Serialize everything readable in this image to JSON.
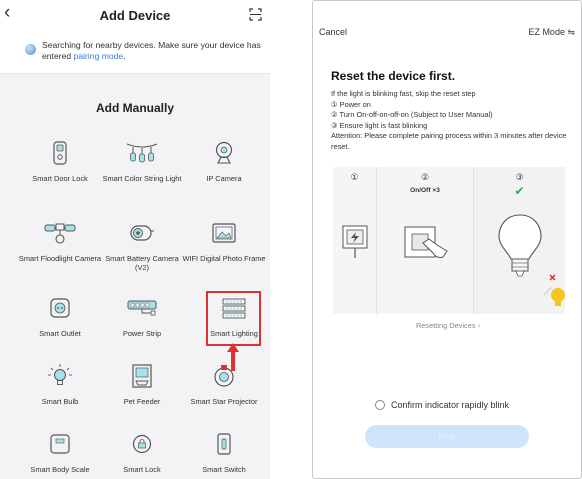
{
  "left": {
    "header": {
      "back": "‹",
      "title": "Add Device"
    },
    "search": {
      "text": "Searching for nearby devices. Make sure your device has entered ",
      "link": "pairing mode",
      "end": "."
    },
    "manual_title": "Add Manually",
    "devices": [
      {
        "label": "Smart Door Lock",
        "icon": "door-lock-icon"
      },
      {
        "label": "Smart Color String Light",
        "icon": "string-light-icon"
      },
      {
        "label": "IP Camera",
        "icon": "ip-camera-icon"
      },
      {
        "label": "Smart Floodlight Camera",
        "icon": "floodlight-camera-icon"
      },
      {
        "label": "Smart Battery Camera (V2)",
        "icon": "battery-camera-icon"
      },
      {
        "label": "WIFI Digital Photo Frame",
        "icon": "photo-frame-icon"
      },
      {
        "label": "Smart Outlet",
        "icon": "outlet-icon"
      },
      {
        "label": "Power Strip",
        "icon": "power-strip-icon"
      },
      {
        "label": "Smart Lighting",
        "icon": "lighting-icon"
      },
      {
        "label": "Smart Bulb",
        "icon": "bulb-icon"
      },
      {
        "label": "Pet Feeder",
        "icon": "pet-feeder-icon"
      },
      {
        "label": "Smart Star Projector",
        "icon": "star-projector-icon"
      },
      {
        "label": "Smart Body Scale",
        "icon": "body-scale-icon"
      },
      {
        "label": "Smart Lock",
        "icon": "smart-lock-icon"
      },
      {
        "label": "Smart Switch",
        "icon": "switch-icon"
      }
    ],
    "highlight_color": "#e03131"
  },
  "right": {
    "cancel": "Cancel",
    "ez_mode": "EZ Mode ⇋",
    "heading": "Reset the device first.",
    "lines": [
      "If the light is blinking fast, skip the reset step",
      "① Power on",
      "② Turn On-off-on-off-on (Subject to User Manual)",
      "③ Ensure light is fast blinking",
      "Attention: Please complete pairing process within 3 minutes after device reset."
    ],
    "steps": {
      "one": "①",
      "two": "②",
      "three": "③",
      "on_off": "On/Off ×3",
      "check": "✔"
    },
    "resetting": "Resetting Devices ›",
    "confirm": "Confirm indicator rapidly blink",
    "next": "Next",
    "accent": "#cfe4fb"
  }
}
